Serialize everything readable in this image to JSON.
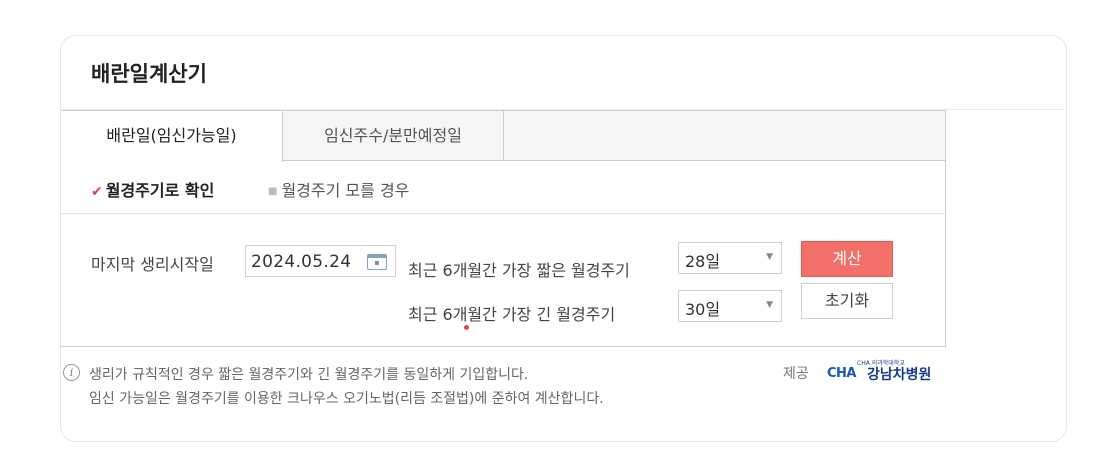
{
  "title": "배란일계산기",
  "tabs": [
    {
      "label": "배란일(임신가능일)",
      "active": true
    },
    {
      "label": "임신주수/분만예정일",
      "active": false
    }
  ],
  "subtabs": [
    {
      "label": "월경주기로 확인",
      "active": true
    },
    {
      "label": "월경주기 모를 경우",
      "active": false
    }
  ],
  "form": {
    "last_period_label": "마지막 생리시작일",
    "last_period_value": "2024.05.24",
    "short_cycle_label": "최근 6개월간 가장 짧은 월경주기",
    "short_cycle_value": "28일",
    "long_cycle_label": "최근 6개월간 가장 긴 월경주기",
    "long_cycle_value": "30일"
  },
  "buttons": {
    "calculate": "계산",
    "reset": "초기화"
  },
  "notes": [
    "생리가 규칙적인 경우 짧은 월경주기와 긴 월경주기를 동일하게 기입합니다.",
    "임신 가능일은 월경주기를 이용한 크나우스 오기노법(리듬 조절법)에 준하여 계산합니다."
  ],
  "provider": {
    "label": "제공",
    "logo_small_text": "CHA 의과학대학교",
    "logo_brand": "CHA",
    "logo_name": "강남차병원"
  },
  "colors": {
    "accent": "#f37069",
    "check": "#e0444e",
    "logo_blue": "#1a3a8a"
  }
}
